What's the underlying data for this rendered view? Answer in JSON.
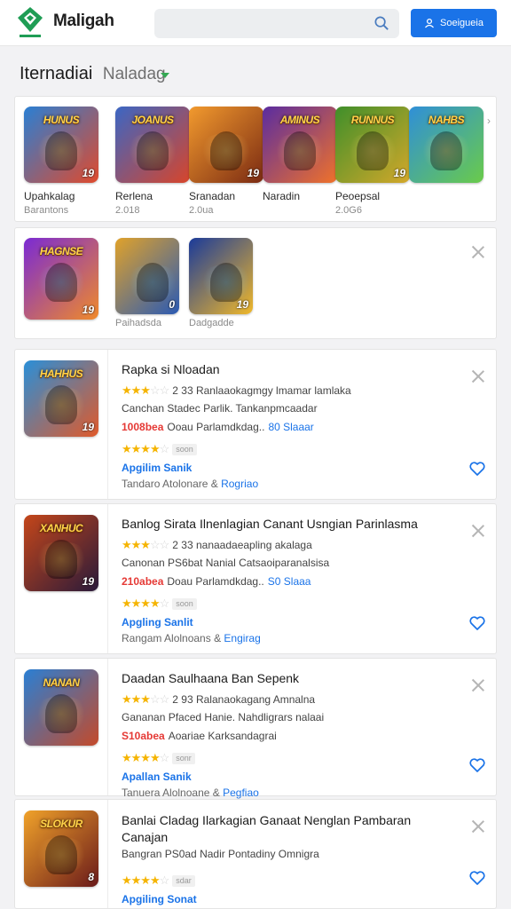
{
  "header": {
    "logo_text": "Maligah",
    "signin_label": "Soeigueia",
    "search_placeholder": ""
  },
  "section": {
    "title_main": "Iternadiai",
    "title_sub": "Naladag"
  },
  "row1": [
    {
      "name": "Upahkalag",
      "sub": "Barantons",
      "logo": "HUNUS",
      "num": "19",
      "bg": "linear-gradient(135deg,#2a7fd4,#e04a2c)"
    },
    {
      "name": "Rerlena",
      "sub": "2.018",
      "logo": "JOANUS",
      "num": "",
      "bg": "linear-gradient(135deg,#3b66c4,#d8452a)"
    },
    {
      "name": "Sranadan",
      "sub": "2.0ua",
      "logo": "",
      "num": "19",
      "bg": "linear-gradient(135deg,#f29a2e,#7a2a12)"
    },
    {
      "name": "Naradin",
      "sub": "",
      "logo": "AMINUS",
      "num": "",
      "bg": "linear-gradient(135deg,#5a2ca0,#f0722a)"
    },
    {
      "name": "Peoepsal",
      "sub": "2.0G6",
      "logo": "RUNNUS",
      "num": "19",
      "bg": "linear-gradient(135deg,#3f8f2a,#d4a82a)"
    },
    {
      "name": "",
      "sub": "",
      "logo": "NAHBS",
      "num": "",
      "bg": "linear-gradient(135deg,#2f8fd8,#6acb4a)"
    }
  ],
  "row2": [
    {
      "name": "",
      "sub": "",
      "logo": "HAGNSE",
      "num": "19",
      "bg": "linear-gradient(135deg,#7a2ad4,#f08a2a)"
    },
    {
      "name": "",
      "sub": "Paihadsda",
      "logo": "",
      "num": "0",
      "bg": "linear-gradient(135deg,#e0a22a,#2a5ab4)"
    },
    {
      "name": "",
      "sub": "Dadgadde",
      "logo": "",
      "num": "19",
      "bg": "linear-gradient(135deg,#1a3a9a,#f0b82a)"
    }
  ],
  "list": [
    {
      "title": "Rapka si Nloadan",
      "stars_text": "2 33 Ranlaaokagmgy lmamar lamlaka",
      "line2": "Canchan Stadec Parlik. Tankanpmcaadar",
      "red": "1008bea",
      "line3": "Ooau Parlamdkdag..",
      "blue3": "80 Slaaar",
      "pill": "soon",
      "link": "Apgilim Sanik",
      "meta": "Tandaro Atolonare &",
      "meta_blue": "Rogriao",
      "logo": "HAHHUS",
      "num": "19",
      "bg": "linear-gradient(135deg,#2a8fd8,#e05a2a)"
    },
    {
      "title": "Banlog Sirata Ilnenlagian Canant Usngian Parinlasma",
      "stars_text": "2 33 nanaadaeapling akalaga",
      "line2": "Canonan PS6bat Nanial Catsaoiparanalsisa",
      "red": "210abea",
      "line3": "Doau Parlamdkdag..",
      "blue3": "S0 Slaaa",
      "pill": "soon",
      "link": "Apgling Sanlit",
      "meta": "Rangam Alolnoans &",
      "meta_blue": "Engirag",
      "logo": "XANHUC",
      "num": "19",
      "bg": "linear-gradient(135deg,#c4461a,#2a1a3a)"
    },
    {
      "title": "Daadan Saulhaana Ban Sepenk",
      "stars_text": "2 93 Ralanaokagang Amnalna",
      "line2": "Gananan Pfaced Hanie. Nahdligrars nalaai",
      "red": "S10abea",
      "line3": "Aoariae Karksandagrai",
      "blue3": "",
      "pill": "sonr",
      "link": "Apallan Sanik",
      "meta": "Tanuera Alolnoane &",
      "meta_blue": "Pegfiao",
      "logo": "NANAN",
      "num": "",
      "bg": "linear-gradient(135deg,#2a7fd4,#c44a2a)"
    },
    {
      "title": "Banlai Cladag Ilarkagian Ganaat Nenglan Pambaran Canajan",
      "stars_text": "",
      "line2": "Bangran PS0ad Nadir Pontadiny Omnigra",
      "red": "",
      "line3": "",
      "blue3": "",
      "pill": "sdar",
      "link": "Apgiling Sonat",
      "meta": "",
      "meta_blue": "",
      "logo": "SLOKUR",
      "num": "8",
      "bg": "linear-gradient(135deg,#f0a22a,#6a1a1a)"
    }
  ],
  "colors": {
    "accent": "#1a73e8",
    "star": "#f5b400",
    "price_red": "#e53935",
    "logo_green": "#34a853"
  }
}
